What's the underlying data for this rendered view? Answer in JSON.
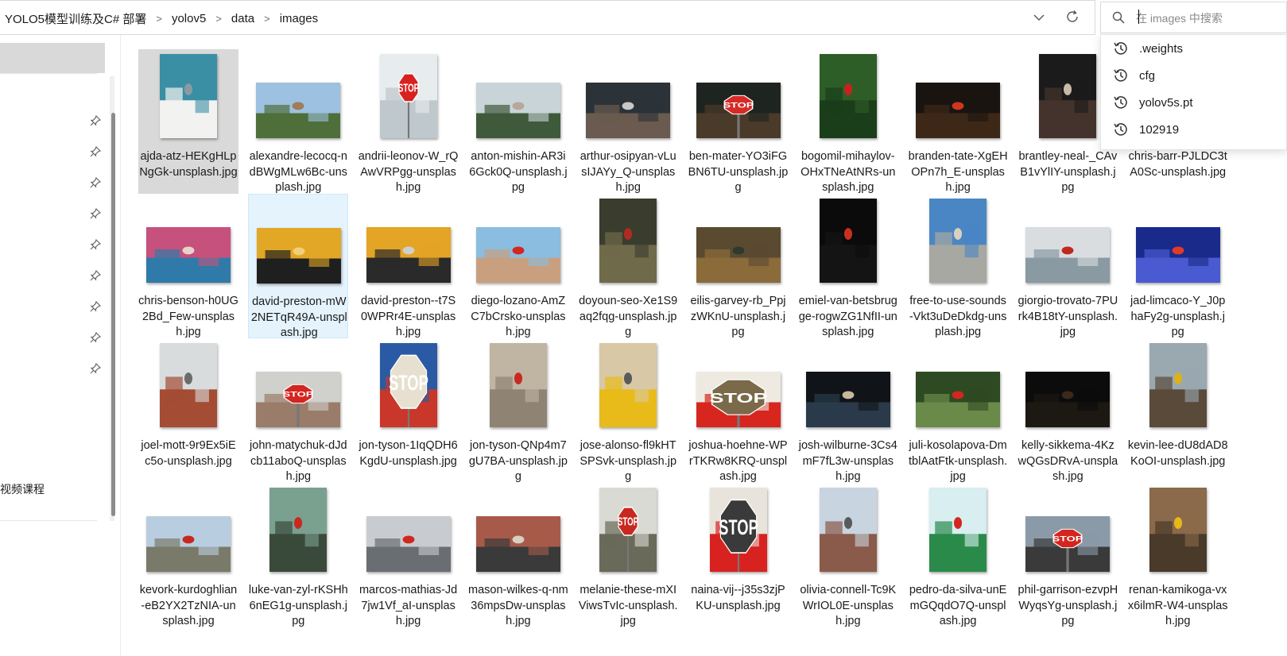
{
  "breadcrumb": [
    "YOLO5模型训练及C# 部署",
    "yolov5",
    "data",
    "images"
  ],
  "search": {
    "placeholder": "在 images 中搜索"
  },
  "suggestions": [
    ".weights",
    "cfg",
    "yolov5s.pt",
    "102919"
  ],
  "nav": {
    "label": "视频课程"
  },
  "icons": {
    "breadcrumb_separator": "chevron-right-icon",
    "history": "history-icon",
    "search": "search-icon",
    "refresh": "refresh-icon",
    "dropdown": "chevron-down-icon",
    "pin": "pin-icon"
  },
  "files": [
    {
      "name": "ajda-atz-HEKgHLpNgGk-unsplash.jpg",
      "palette": [
        "#3a8fa5",
        "#f2f2f0",
        "#8a9aa3"
      ],
      "orient": "portrait",
      "selected": "grey"
    },
    {
      "name": "alexandre-lecocq-ndBWgMLw6Bc-unsplash.jpg",
      "palette": [
        "#9dc1e0",
        "#4e6e3a",
        "#a17b5a"
      ],
      "orient": "landscape"
    },
    {
      "name": "andrii-leonov-W_rQAwVRPgg-unsplash.jpg",
      "palette": [
        "#e7ecef",
        "#bfc8cc",
        "#d8221f"
      ],
      "orient": "portrait",
      "stop": true
    },
    {
      "name": "anton-mishin-AR3i6Gck0Q-unsplash.jpg",
      "palette": [
        "#c9d4d8",
        "#3f5a3a",
        "#b8a79a"
      ],
      "orient": "landscape"
    },
    {
      "name": "arthur-osipyan-vLusIJAYy_Q-unsplash.jpg",
      "palette": [
        "#2b3238",
        "#6a5a4f",
        "#c8c8c8"
      ],
      "orient": "landscape"
    },
    {
      "name": "ben-mater-YO3iFGBN6TU-unsplash.jpg",
      "palette": [
        "#1e2420",
        "#4a3a2a",
        "#d62a27"
      ],
      "orient": "landscape",
      "stop": true
    },
    {
      "name": "bogomil-mihaylov-OHxTNeAtNRs-unsplash.jpg",
      "palette": [
        "#2e5e28",
        "#1a3d1a",
        "#c9221e"
      ],
      "orient": "portrait"
    },
    {
      "name": "branden-tate-XgEHOPn7h_E-unsplash.jpg",
      "palette": [
        "#1a1410",
        "#3d2818",
        "#d0351f"
      ],
      "orient": "landscape"
    },
    {
      "name": "brantley-neal-_CAvB1vYlIY-unsplash.jpg",
      "palette": [
        "#1b1b1b",
        "#44332c",
        "#c7b9a7"
      ],
      "orient": "portrait"
    },
    {
      "name": "chris-barr-PJLDC3tA0Sc-unsplash.jpg",
      "palette": [
        "#5f7b93",
        "#b6c2c8",
        "#3b3b3b"
      ],
      "orient": "landscape"
    },
    {
      "name": "chris-benson-h0UG2Bd_Few-unsplash.jpg",
      "palette": [
        "#c6517c",
        "#2f7aa8",
        "#e7d3c8"
      ],
      "orient": "landscape"
    },
    {
      "name": "david-preston-mW2NETqR49A-unsplash.jpg",
      "palette": [
        "#e3a726",
        "#1f1f1f",
        "#f0d07a"
      ],
      "orient": "landscape",
      "selected": "blue"
    },
    {
      "name": "david-preston--t7S0WPRr4E-unsplash.jpg",
      "palette": [
        "#e4a425",
        "#2a2a2a",
        "#cfcfcf"
      ],
      "orient": "landscape"
    },
    {
      "name": "diego-lozano-AmZC7bCrsko-unsplash.jpg",
      "palette": [
        "#8bbde0",
        "#c8a080",
        "#d2281f"
      ],
      "orient": "landscape"
    },
    {
      "name": "doyoun-seo-Xe1S9aq2fqg-unsplash.jpg",
      "palette": [
        "#3a3d2e",
        "#6f6a4a",
        "#b12a22"
      ],
      "orient": "portrait"
    },
    {
      "name": "eilis-garvey-rb_PpjzWKnU-unsplash.jpg",
      "palette": [
        "#5a4a30",
        "#8b6b3a",
        "#2e3a2e"
      ],
      "orient": "landscape"
    },
    {
      "name": "emiel-van-betsbrugge-rogwZG1NfII-unsplash.jpg",
      "palette": [
        "#0b0b0b",
        "#141414",
        "#c8301f"
      ],
      "orient": "portrait"
    },
    {
      "name": "free-to-use-sounds-Vkt3uDeDkdg-unsplash.jpg",
      "palette": [
        "#4a86c4",
        "#a7a8a2",
        "#d8d1c0"
      ],
      "orient": "portrait"
    },
    {
      "name": "giorgio-trovato-7PUrk4B18tY-unsplash.jpg",
      "palette": [
        "#d9dde0",
        "#8a9aa3",
        "#c0281f"
      ],
      "orient": "landscape"
    },
    {
      "name": "jad-limcaco-Y_J0phaFy2g-unsplash.jpg",
      "palette": [
        "#1a2a8a",
        "#4a5ad0",
        "#e23a2a"
      ],
      "orient": "landscape"
    },
    {
      "name": "joel-mott-9r9Ex5iEc5o-unsplash.jpg",
      "palette": [
        "#d8dcdc",
        "#a44c34",
        "#6c6c6c"
      ],
      "orient": "portrait"
    },
    {
      "name": "john-matychuk-dJdcb11aboQ-unsplash.jpg",
      "palette": [
        "#d0d0cc",
        "#9a7c6a",
        "#d4251f"
      ],
      "orient": "landscape",
      "stop": true
    },
    {
      "name": "jon-tyson-1IqQDH6KgdU-unsplash.jpg",
      "palette": [
        "#2b5aa5",
        "#c8372a",
        "#e7e0d0"
      ],
      "orient": "portrait",
      "stop": true,
      "bigstop": true
    },
    {
      "name": "jon-tyson-QNp4m7gU7BA-unsplash.jpg",
      "palette": [
        "#c0b5a3",
        "#8f8474",
        "#c82a22"
      ],
      "orient": "portrait"
    },
    {
      "name": "jose-alonso-fl9kHTSPSvk-unsplash.jpg",
      "palette": [
        "#d8c8a5",
        "#e8bb1a",
        "#5a5a5a"
      ],
      "orient": "portrait"
    },
    {
      "name": "joshua-hoehne-WPrTKRw8KRQ-unsplash.jpg",
      "palette": [
        "#eeeae2",
        "#d6261e",
        "#7a6a4a"
      ],
      "orient": "landscape",
      "stop": true,
      "bigstop": true
    },
    {
      "name": "josh-wilburne-3Cs4mF7fL3w-unsplash.jpg",
      "palette": [
        "#101418",
        "#2a3a4a",
        "#c8b89a"
      ],
      "orient": "landscape"
    },
    {
      "name": "juli-kosolapova-DmtblAatFtk-unsplash.jpg",
      "palette": [
        "#2e4a22",
        "#6a8a4a",
        "#d3261f"
      ],
      "orient": "landscape"
    },
    {
      "name": "kelly-sikkema-4KzwQGsDRvA-unsplash.jpg",
      "palette": [
        "#0c0c0c",
        "#1c1812",
        "#3a2a1a"
      ],
      "orient": "landscape"
    },
    {
      "name": "kevin-lee-dU8dAD8KoOI-unsplash.jpg",
      "palette": [
        "#9aa8b0",
        "#5a4a3a",
        "#d9b21e"
      ],
      "orient": "portrait"
    },
    {
      "name": "kevork-kurdoghlian-eB2YX2TzNIA-unsplash.jpg",
      "palette": [
        "#b9cde0",
        "#7a7a6a",
        "#c8281f"
      ],
      "orient": "landscape"
    },
    {
      "name": "luke-van-zyl-rKSHh6nEG1g-unsplash.jpg",
      "palette": [
        "#7aa090",
        "#3a4a3a",
        "#c8281f"
      ],
      "orient": "portrait"
    },
    {
      "name": "marcos-mathias-Jd7jw1Vf_aI-unsplash.jpg",
      "palette": [
        "#c8ccd0",
        "#6a6e72",
        "#d3261f"
      ],
      "orient": "landscape"
    },
    {
      "name": "mason-wilkes-q-nm36mpsDw-unsplash.jpg",
      "palette": [
        "#a85a4a",
        "#3a3a3a",
        "#d8d0c0"
      ],
      "orient": "landscape"
    },
    {
      "name": "melanie-these-mXIViwsTvIc-unsplash.jpg",
      "palette": [
        "#dadad4",
        "#6a6a5a",
        "#c8281f"
      ],
      "orient": "portrait",
      "stop": true
    },
    {
      "name": "naina-vij--j35s3zjPKU-unsplash.jpg",
      "palette": [
        "#e8e4dc",
        "#d8221f",
        "#3a3a3a"
      ],
      "orient": "portrait",
      "stop": true,
      "bigstop": true
    },
    {
      "name": "olivia-connell-Tc9KWrIOL0E-unsplash.jpg",
      "palette": [
        "#c8d4e0",
        "#8a5a4a",
        "#5a5a5a"
      ],
      "orient": "portrait"
    },
    {
      "name": "pedro-da-silva-unEmGQqdO7Q-unsplash.jpg",
      "palette": [
        "#d8eef0",
        "#2a8a4a",
        "#d3261f"
      ],
      "orient": "portrait"
    },
    {
      "name": "phil-garrison-ezvpHWyqsYg-unsplash.jpg",
      "palette": [
        "#8a9aa8",
        "#3a3a3a",
        "#d3261f"
      ],
      "orient": "landscape",
      "stop": true
    },
    {
      "name": "renan-kamikoga-vxx6ilmR-W4-unsplash.jpg",
      "palette": [
        "#8a6a4a",
        "#4a3a2a",
        "#e8b81a"
      ],
      "orient": "portrait"
    }
  ]
}
